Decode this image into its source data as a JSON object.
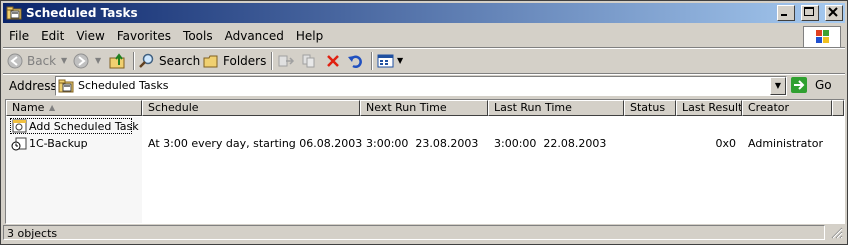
{
  "window": {
    "title": "Scheduled Tasks"
  },
  "menu": [
    "File",
    "Edit",
    "View",
    "Favorites",
    "Tools",
    "Advanced",
    "Help"
  ],
  "toolbar": {
    "back": "Back",
    "search": "Search",
    "folders": "Folders"
  },
  "address": {
    "label": "Address",
    "value": "Scheduled Tasks",
    "go": "Go"
  },
  "columns": [
    "Name",
    "Schedule",
    "Next Run Time",
    "Last Run Time",
    "Status",
    "Last Result",
    "Creator"
  ],
  "rows": [
    {
      "name": "Add Scheduled Task",
      "schedule": "",
      "next": "",
      "last": "",
      "status": "",
      "result": "",
      "creator": ""
    },
    {
      "name": "1C-Backup",
      "schedule": "At 3:00 every day, starting 06.08.2003",
      "next": "3:00:00  23.08.2003",
      "last": "3:00:00  22.08.2003",
      "status": "",
      "result": "0x0",
      "creator": "Administrator"
    }
  ],
  "statusbar": {
    "text": "3 objects"
  }
}
